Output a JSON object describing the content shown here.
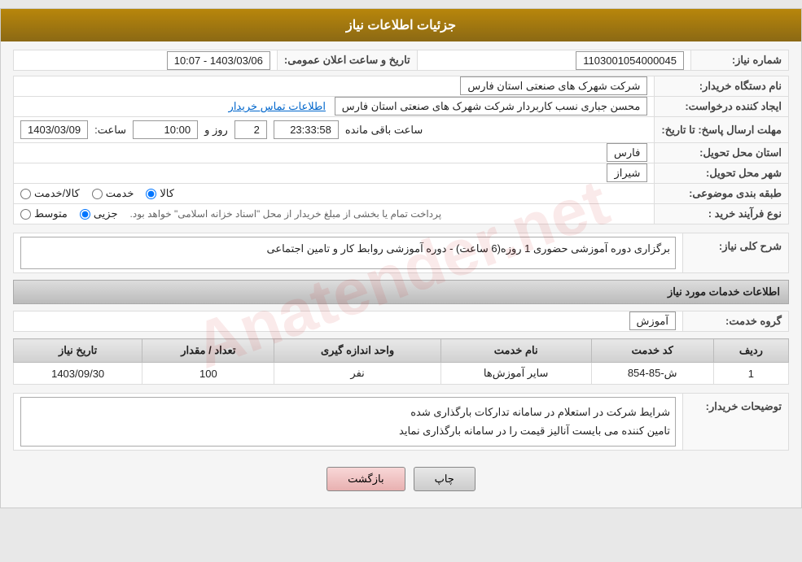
{
  "header": {
    "title": "جزئیات اطلاعات نیاز"
  },
  "fields": {
    "need_number_label": "شماره نیاز:",
    "need_number_value": "1103001054000045",
    "announcement_date_label": "تاریخ و ساعت اعلان عمومی:",
    "announcement_date_value": "1403/03/06 - 10:07",
    "buyer_org_label": "نام دستگاه خریدار:",
    "buyer_org_value": "شرکت شهرک های صنعتی استان فارس",
    "creator_label": "ایجاد کننده درخواست:",
    "creator_value": "محسن  جباری نسب کاربردار شرکت شهرک های صنعتی استان فارس",
    "contact_link": "اطلاعات تماس خریدار",
    "deadline_label": "مهلت ارسال پاسخ: تا تاریخ:",
    "deadline_date": "1403/03/09",
    "deadline_time_label": "ساعت:",
    "deadline_time": "10:00",
    "deadline_day_label": "روز و",
    "deadline_days": "2",
    "deadline_remaining_label": "ساعت باقی مانده",
    "deadline_remaining": "23:33:58",
    "province_label": "استان محل تحویل:",
    "province_value": "فارس",
    "city_label": "شهر محل تحویل:",
    "city_value": "شیراز",
    "category_label": "طبقه بندی موضوعی:",
    "category_kala": "کالا",
    "category_khadamat": "خدمت",
    "category_kala_khadamat": "کالا/خدمت",
    "purchase_type_label": "نوع فرآیند خرید :",
    "purchase_jozei": "جزیی",
    "purchase_motavaset": "متوسط",
    "purchase_notice": "پرداخت تمام یا بخشی از مبلغ خریدار از محل \"اسناد خزانه اسلامی\" خواهد بود.",
    "description_label": "شرح کلی نیاز:",
    "description_value": "برگزاری دوره آموزشی حضوری 1 روزه(6 ساعت) - دوره آموزشی روابط کار و تامین اجتماعی",
    "service_info_title": "اطلاعات خدمات مورد نیاز",
    "service_group_label": "گروه خدمت:",
    "service_group_value": "آموزش",
    "table": {
      "col_row": "ردیف",
      "col_code": "کد خدمت",
      "col_name": "نام خدمت",
      "col_unit": "واحد اندازه گیری",
      "col_quantity": "تعداد / مقدار",
      "col_date": "تاریخ نیاز",
      "rows": [
        {
          "row": "1",
          "code": "ش-85-854",
          "name": "سایر آموزش‌ها",
          "unit": "نفر",
          "quantity": "100",
          "date": "1403/09/30"
        }
      ]
    },
    "buyer_notes_label": "توضیحات خریدار:",
    "buyer_notes_value": "شرایط شرکت در استعلام در سامانه تدارکات بارگذاری شده\nتامین کننده می بایست آنالیز قیمت را در سامانه بارگذاری نماید"
  },
  "buttons": {
    "print_label": "چاپ",
    "back_label": "بازگشت"
  }
}
